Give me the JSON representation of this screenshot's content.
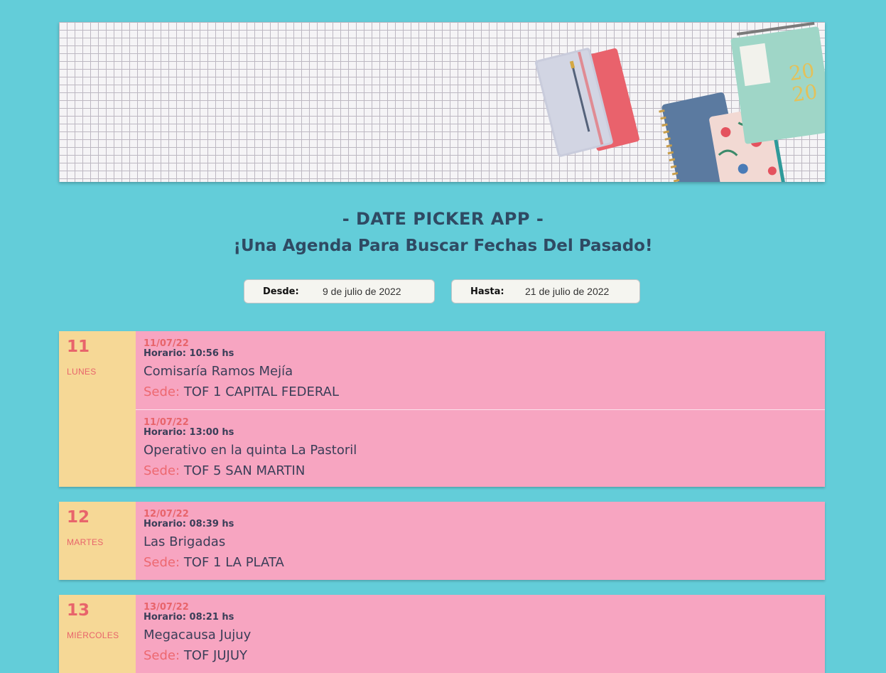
{
  "header": {
    "title": "- DATE PICKER APP -",
    "subtitle": "¡Una Agenda Para Buscar Fechas Del Pasado!"
  },
  "filters": {
    "desde": {
      "label": "Desde:",
      "value": "9 de julio de 2022"
    },
    "hasta": {
      "label": "Hasta:",
      "value": "21 de julio de 2022"
    }
  },
  "sede_label": "Sede:",
  "days": [
    {
      "num": "11",
      "name": "LUNES",
      "events": [
        {
          "date": "11/07/22",
          "time": "Horario: 10:56 hs",
          "title": "Comisaría Ramos Mejía",
          "sede": "TOF 1 CAPITAL FEDERAL"
        },
        {
          "date": "11/07/22",
          "time": "Horario: 13:00 hs",
          "title": "Operativo en la quinta La Pastoril",
          "sede": "TOF 5 SAN MARTIN"
        }
      ]
    },
    {
      "num": "12",
      "name": "MARTES",
      "events": [
        {
          "date": "12/07/22",
          "time": "Horario: 08:39 hs",
          "title": "Las Brigadas",
          "sede": "TOF 1 LA PLATA"
        }
      ]
    },
    {
      "num": "13",
      "name": "MIÉRCOLES",
      "events": [
        {
          "date": "13/07/22",
          "time": "Horario: 08:21 hs",
          "title": "Megacausa Jujuy",
          "sede": "TOF JUJUY"
        }
      ]
    }
  ],
  "colors": {
    "background": "#63cdd9",
    "day_side": "#f6d896",
    "day_events": "#f7a5c1",
    "accent": "#e8646b",
    "text_dark": "#2f4a63"
  }
}
